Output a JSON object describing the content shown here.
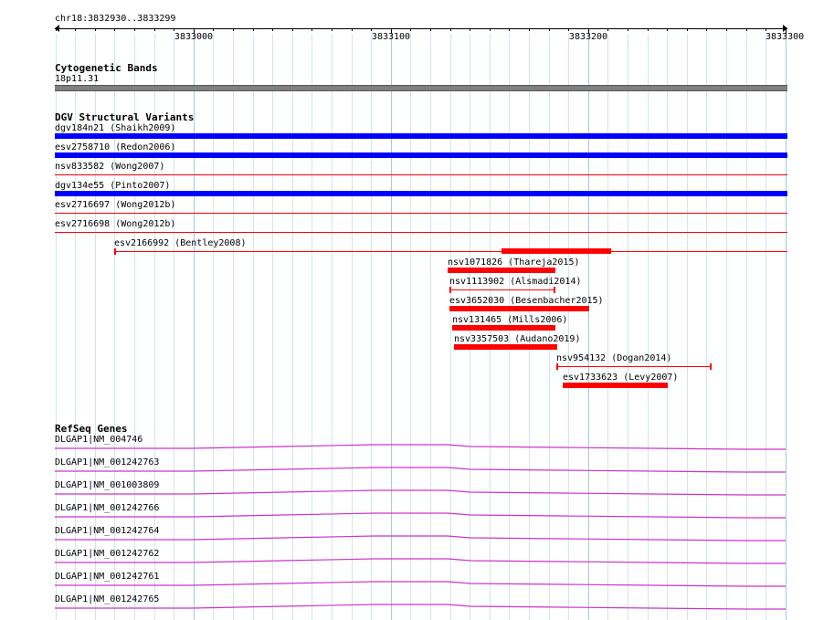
{
  "ruler": {
    "location": "chr18:3832930..3833299",
    "ticks": [
      "3833000",
      "3833100",
      "3833200",
      "3833300"
    ]
  },
  "cytoband": {
    "title": "Cytogenetic Bands",
    "band_name": "18p11.31",
    "color": "#808080"
  },
  "dgv": {
    "title": "DGV Structural Variants",
    "gain_color": "#0000ff",
    "loss_color": "#ff0000",
    "features": [
      {
        "label": "dgv184n21 (Shaikh2009)"
      },
      {
        "label": "esv2758710 (Redon2006)"
      },
      {
        "label": "nsv833582 (Wong2007)"
      },
      {
        "label": "dgv134e55 (Pinto2007)"
      },
      {
        "label": "esv2716697 (Wong2012b)"
      },
      {
        "label": "esv2716698 (Wong2012b)"
      },
      {
        "label": "esv2166992 (Bentley2008)"
      },
      {
        "label": "nsv1071826 (Thareja2015)"
      },
      {
        "label": "nsv1113902 (Alsmadi2014)"
      },
      {
        "label": "esv3652030 (Besenbacher2015)"
      },
      {
        "label": "nsv131465 (Mills2006)"
      },
      {
        "label": "nsv3357503 (Audano2019)"
      },
      {
        "label": "nsv954132 (Dogan2014)"
      },
      {
        "label": "esv1733623 (Levy2007)"
      }
    ]
  },
  "genes": {
    "title": "RefSeq Genes",
    "color": "#cc33cc",
    "transcripts": [
      {
        "label": "DLGAP1|NM_004746"
      },
      {
        "label": "DLGAP1|NM_001242763"
      },
      {
        "label": "DLGAP1|NM_001003809"
      },
      {
        "label": "DLGAP1|NM_001242766"
      },
      {
        "label": "DLGAP1|NM_001242764"
      },
      {
        "label": "DLGAP1|NM_001242762"
      },
      {
        "label": "DLGAP1|NM_001242761"
      },
      {
        "label": "DLGAP1|NM_001242765"
      }
    ]
  }
}
